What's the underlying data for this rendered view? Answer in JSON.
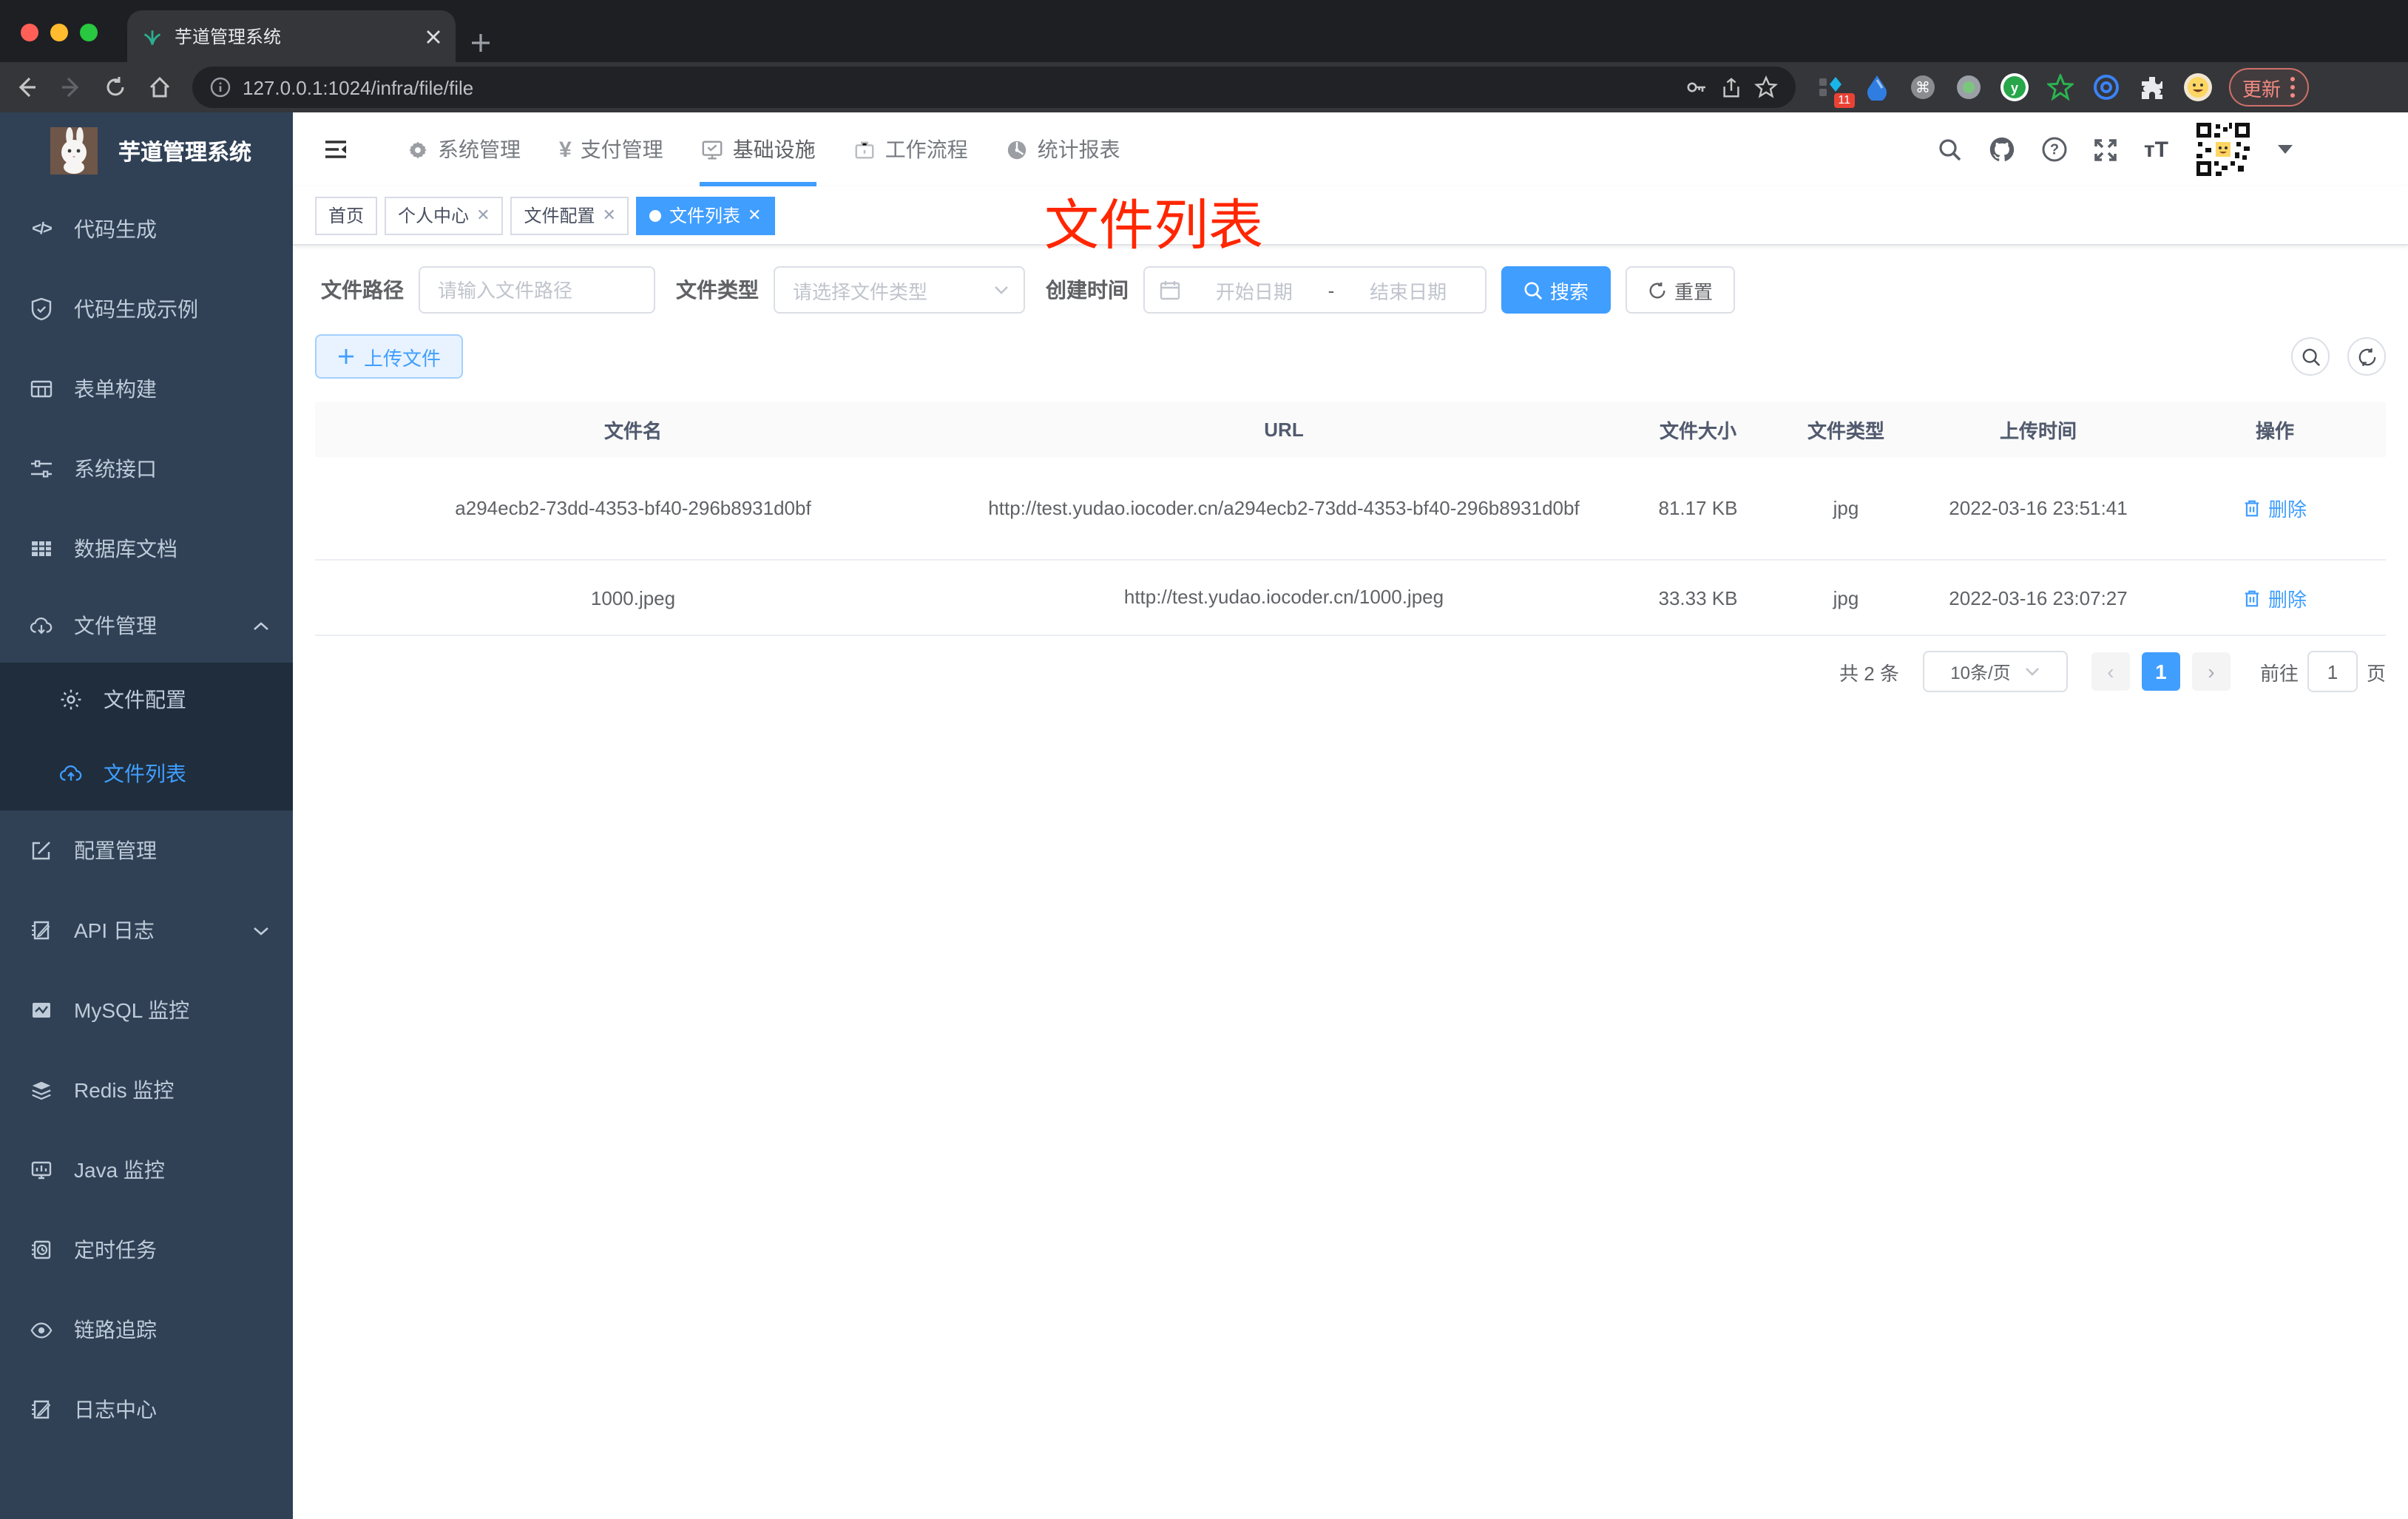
{
  "colors": {
    "accent": "#409eff",
    "annotation_red": "#ff2600",
    "sidebar_bg": "#304156",
    "submenu_bg": "#1f2d3d",
    "delete_link": "#409eff"
  },
  "browser": {
    "tab_title": "芋道管理系统",
    "url": "127.0.0.1:1024/infra/file/file",
    "update_label": "更新",
    "extension_badge": "11"
  },
  "sidebar": {
    "title": "芋道管理系统",
    "items": [
      {
        "icon": "code-icon",
        "label": "代码生成"
      },
      {
        "icon": "shield-check-icon",
        "label": "代码生成示例"
      },
      {
        "icon": "form-table-icon",
        "label": "表单构建"
      },
      {
        "icon": "sliders-icon",
        "label": "系统接口"
      },
      {
        "icon": "database-grid-icon",
        "label": "数据库文档"
      },
      {
        "icon": "cloud-download-icon",
        "label": "文件管理"
      },
      {
        "icon": "gear-icon",
        "label": "文件配置"
      },
      {
        "icon": "cloud-upload-icon",
        "label": "文件列表"
      },
      {
        "icon": "edit-square-icon",
        "label": "配置管理"
      },
      {
        "icon": "api-log-icon",
        "label": "API 日志"
      },
      {
        "icon": "chart-monitor-icon",
        "label": "MySQL 监控"
      },
      {
        "icon": "stack-icon",
        "label": "Redis 监控"
      },
      {
        "icon": "monitor-icon",
        "label": "Java 监控"
      },
      {
        "icon": "schedule-icon",
        "label": "定时任务"
      },
      {
        "icon": "eye-icon",
        "label": "链路追踪"
      },
      {
        "icon": "log-edit-icon",
        "label": "日志中心"
      }
    ]
  },
  "header": {
    "menus": [
      {
        "icon": "gear-icon",
        "label": "系统管理"
      },
      {
        "icon": "yen-icon",
        "label": "支付管理"
      },
      {
        "icon": "infra-icon",
        "label": "基础设施"
      },
      {
        "icon": "workflow-icon",
        "label": "工作流程"
      },
      {
        "icon": "report-icon",
        "label": "统计报表"
      }
    ],
    "active_menu": "基础设施"
  },
  "tags": [
    {
      "label": "首页"
    },
    {
      "label": "个人中心"
    },
    {
      "label": "文件配置"
    },
    {
      "label": "文件列表"
    }
  ],
  "annotation": "文件列表",
  "filters": {
    "path_label": "文件路径",
    "path_placeholder": "请输入文件路径",
    "type_label": "文件类型",
    "type_placeholder": "请选择文件类型",
    "date_label": "创建时间",
    "date_start": "开始日期",
    "date_sep": "-",
    "date_end": "结束日期",
    "search_label": "搜索",
    "reset_label": "重置"
  },
  "toolbar": {
    "upload_label": "上传文件"
  },
  "table": {
    "columns": [
      "文件名",
      "URL",
      "文件大小",
      "文件类型",
      "上传时间",
      "操作"
    ],
    "rows": [
      {
        "name": "a294ecb2-73dd-4353-bf40-296b8931d0bf",
        "url": "http://test.yudao.iocoder.cn/a294ecb2-73dd-4353-bf40-296b8931d0bf",
        "size": "81.17 KB",
        "type": "jpg",
        "time": "2022-03-16 23:51:41",
        "action": "删除"
      },
      {
        "name": "1000.jpeg",
        "url": "http://test.yudao.iocoder.cn/1000.jpeg",
        "size": "33.33 KB",
        "type": "jpg",
        "time": "2022-03-16 23:07:27",
        "action": "删除"
      }
    ]
  },
  "pagination": {
    "total": "共 2 条",
    "page_size": "10条/页",
    "prev": "‹",
    "page": "1",
    "next": "›",
    "goto_label": "前往",
    "goto_value": "1",
    "unit_label": "页"
  }
}
